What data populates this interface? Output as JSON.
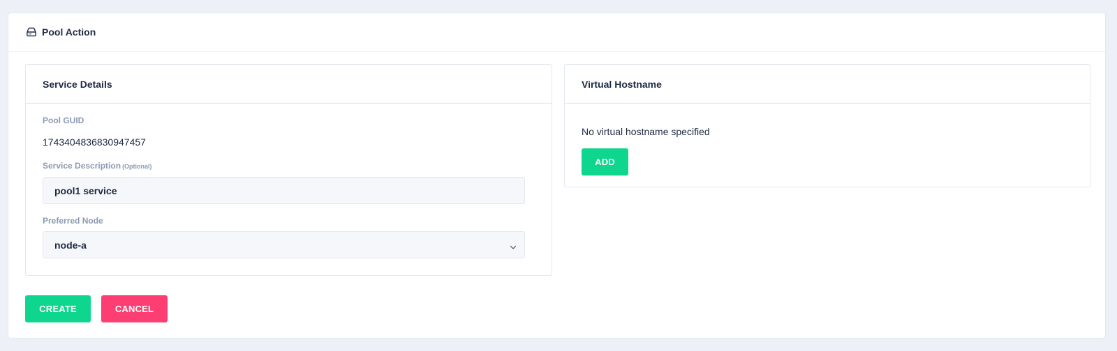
{
  "header": {
    "title": "Pool Action",
    "icon": "drive-icon"
  },
  "service_details": {
    "title": "Service Details",
    "pool_guid_label": "Pool GUID",
    "pool_guid_value": "1743404836830947457",
    "description_label": "Service Description",
    "description_optional": "(Optional)",
    "description_value": "pool1 service",
    "preferred_node_label": "Preferred Node",
    "preferred_node_value": "node-a"
  },
  "virtual_hostname": {
    "title": "Virtual Hostname",
    "empty_text": "No virtual hostname specified",
    "add_label": "ADD"
  },
  "actions": {
    "create_label": "CREATE",
    "cancel_label": "CANCEL"
  },
  "colors": {
    "page_background": "#edf0f7",
    "primary_green": "#0fd68f",
    "danger_pink": "#fc3e72",
    "text_dark": "#1e2a42",
    "label_gray": "#8c99b0"
  }
}
